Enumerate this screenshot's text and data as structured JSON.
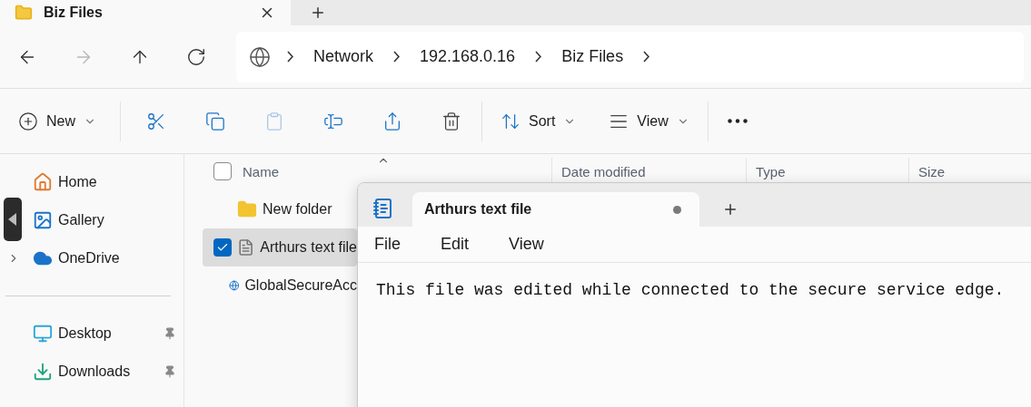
{
  "tabs": [
    {
      "label": "Biz Files",
      "selected": true
    }
  ],
  "nav": [
    {
      "kind": "back",
      "disabled": false
    },
    {
      "kind": "forward",
      "disabled": true
    },
    {
      "kind": "up",
      "disabled": false
    },
    {
      "kind": "refresh",
      "disabled": false
    }
  ],
  "breadcrumbs": [
    "Network",
    "192.168.0.16",
    "Biz Files"
  ],
  "toolbar": {
    "new_label": "New",
    "actions": [
      {
        "kind": "cut",
        "disabled": false
      },
      {
        "kind": "copy",
        "disabled": false
      },
      {
        "kind": "paste",
        "disabled": true
      },
      {
        "kind": "rename",
        "disabled": false
      },
      {
        "kind": "share",
        "disabled": false
      },
      {
        "kind": "delete",
        "disabled": false
      }
    ],
    "sort_label": "Sort",
    "view_label": "View"
  },
  "sidebar": {
    "items": [
      {
        "label": "Home",
        "kind": "home"
      },
      {
        "label": "Gallery",
        "kind": "gallery"
      },
      {
        "label": "OneDrive",
        "kind": "cloud",
        "expanded": false
      }
    ],
    "quick_access": [
      {
        "label": "Desktop",
        "kind": "desktop"
      },
      {
        "label": "Downloads",
        "kind": "downloads"
      }
    ]
  },
  "select_all": {
    "checked": false
  },
  "columns": [
    "Name",
    "Date modified",
    "Type",
    "Size"
  ],
  "files": [
    {
      "name": "New folder",
      "kind": "folder",
      "selected": false
    },
    {
      "name": "Arthurs text file",
      "kind": "text",
      "selected": true
    },
    {
      "name": "GlobalSecureAcc",
      "kind": "web",
      "selected": false
    }
  ],
  "notepad": {
    "tab": {
      "label": "Arthurs text file",
      "unsaved": true
    },
    "menu": [
      "File",
      "Edit",
      "View"
    ],
    "text": "This file was edited while connected to the secure service edge."
  }
}
